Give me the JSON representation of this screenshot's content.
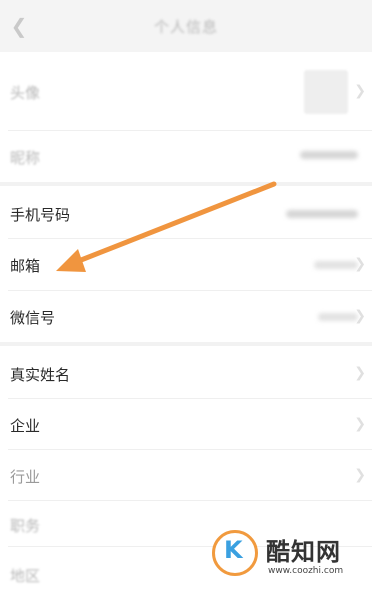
{
  "header": {
    "title": "个人信息"
  },
  "profile": {
    "rows": [
      {
        "label": "头像"
      },
      {
        "label": "昵称"
      }
    ]
  },
  "contact": {
    "rows": [
      {
        "label": "手机号码"
      },
      {
        "label": "邮箱"
      },
      {
        "label": "微信号"
      }
    ]
  },
  "details": {
    "rows": [
      {
        "label": "真实姓名"
      },
      {
        "label": "企业"
      },
      {
        "label": "行业"
      },
      {
        "label": "职务"
      },
      {
        "label": "地区"
      }
    ]
  },
  "watermark": {
    "name": "酷知网",
    "url": "www.coozhi.com"
  },
  "colors": {
    "arrow": "#f0953f",
    "logo_blue": "#3aa0e0",
    "logo_orange": "#f19a3e"
  }
}
